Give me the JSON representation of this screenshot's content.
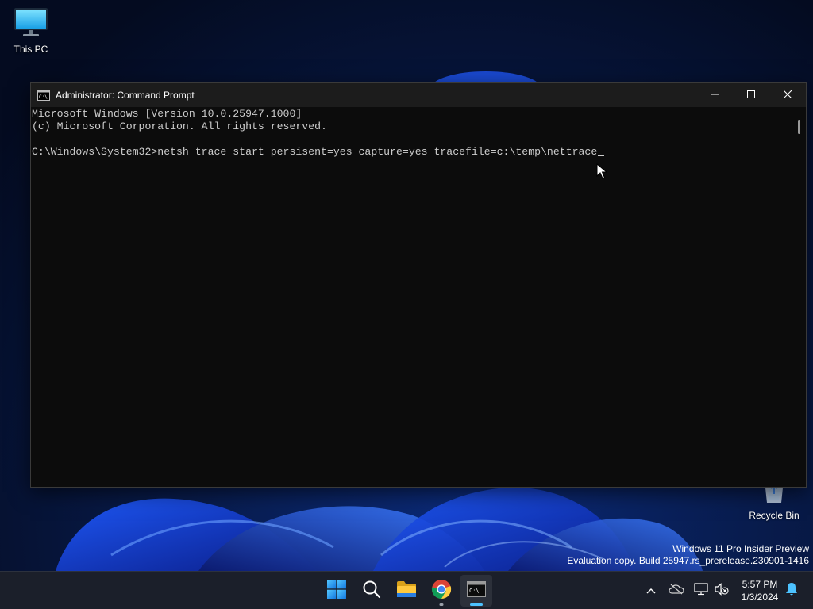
{
  "desktop": {
    "icons": [
      {
        "label": "This PC",
        "icon": "monitor-icon"
      },
      {
        "label": "Recycle Bin",
        "icon": "recycle-bin-icon"
      }
    ],
    "watermark": {
      "line1": "Windows 11 Pro Insider Preview",
      "line2": "Evaluation copy. Build 25947.rs_prerelease.230901-1416"
    }
  },
  "window": {
    "title": "Administrator: Command Prompt",
    "icon": "console-app-icon",
    "controls": [
      "minimize",
      "maximize",
      "close"
    ],
    "console_lines": [
      "Microsoft Windows [Version 10.0.25947.1000]",
      "(c) Microsoft Corporation. All rights reserved.",
      "",
      "C:\\Windows\\System32>netsh trace start persisent=yes capture=yes tracefile=c:\\temp\\nettrace"
    ]
  },
  "taskbar": {
    "apps": [
      {
        "name": "Start",
        "icon": "windows-logo-icon"
      },
      {
        "name": "Search",
        "icon": "search-icon"
      },
      {
        "name": "File Explorer",
        "icon": "folder-icon"
      },
      {
        "name": "Google Chrome",
        "icon": "chrome-icon",
        "running": true
      },
      {
        "name": "Command Prompt",
        "icon": "terminal-icon",
        "running": true,
        "active": true
      }
    ],
    "tray": {
      "icons": [
        "chevron-up-icon",
        "onedrive-offline-icon",
        "network-icon",
        "volume-muted-icon",
        "notification-bell-icon"
      ],
      "time": "5:57 PM",
      "date": "1/3/2024"
    }
  },
  "colors": {
    "console_bg": "#0c0c0c",
    "console_text": "#cccccc",
    "titlebar_bg": "#1c1c1c",
    "taskbar_bg": "#1b1f2a",
    "accent": "#4cc2ff"
  }
}
